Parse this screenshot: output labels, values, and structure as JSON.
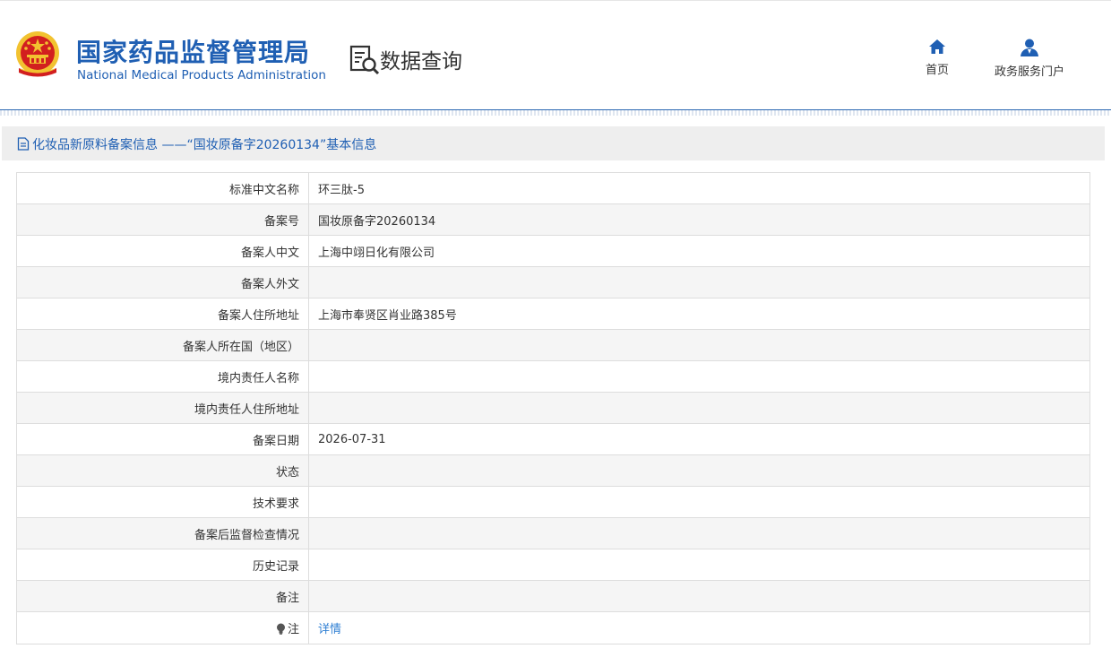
{
  "header": {
    "agency_cn": "国家药品监督管理局",
    "agency_en": "National Medical Products Administration",
    "section_title": "数据查询",
    "nav": [
      {
        "label": "首页",
        "icon": "home-icon"
      },
      {
        "label": "政务服务门户",
        "icon": "user-icon"
      }
    ]
  },
  "title_bar": {
    "icon": "document-icon",
    "text": "化妆品新原料备案信息 ——“国妆原备字20260134”基本信息"
  },
  "rows": [
    {
      "label": "标准中文名称",
      "value": "环三肽-5"
    },
    {
      "label": "备案号",
      "value": "国妆原备字20260134"
    },
    {
      "label": "备案人中文",
      "value": "上海中翊日化有限公司"
    },
    {
      "label": "备案人外文",
      "value": ""
    },
    {
      "label": "备案人住所地址",
      "value": "上海市奉贤区肖业路385号"
    },
    {
      "label": "备案人所在国（地区）",
      "value": ""
    },
    {
      "label": "境内责任人名称",
      "value": ""
    },
    {
      "label": "境内责任人住所地址",
      "value": ""
    },
    {
      "label": "备案日期",
      "value": "2026-07-31"
    },
    {
      "label": "状态",
      "value": ""
    },
    {
      "label": "技术要求",
      "value": ""
    },
    {
      "label": "备案后监督检查情况",
      "value": ""
    },
    {
      "label": "历史记录",
      "value": ""
    },
    {
      "label": "备注",
      "value": ""
    }
  ],
  "note_row": {
    "label": "注",
    "icon": "lightbulb-icon",
    "link_text": "详情"
  },
  "colors": {
    "brand_blue": "#1f5fb3",
    "link_blue": "#2f7fd3",
    "emblem_red": "#d21f1f",
    "emblem_gold": "#f2c230"
  }
}
